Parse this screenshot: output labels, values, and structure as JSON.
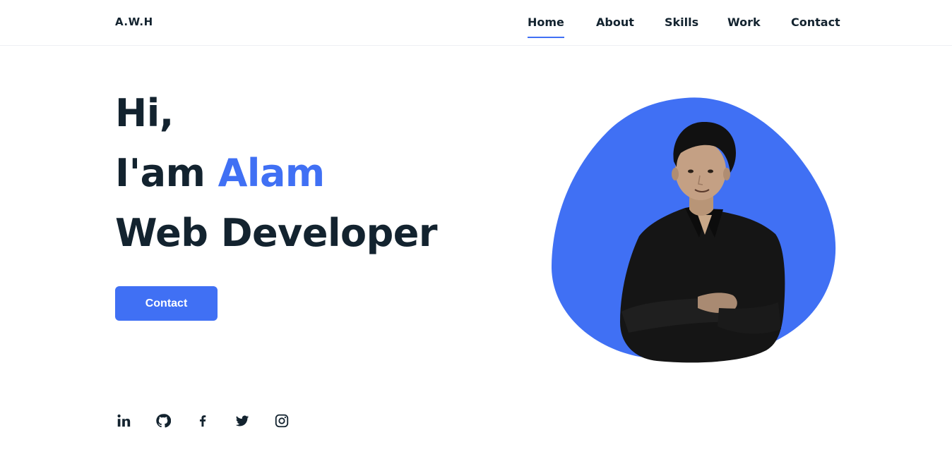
{
  "header": {
    "logo": "A.W.H",
    "nav": [
      {
        "label": "Home",
        "active": true
      },
      {
        "label": "About",
        "active": false
      },
      {
        "label": "Skills",
        "active": false
      },
      {
        "label": "Work",
        "active": false
      },
      {
        "label": "Contact",
        "active": false
      }
    ]
  },
  "hero": {
    "greeting": "Hi,",
    "intro_prefix": "I'am ",
    "name": "Alam",
    "role": "Web Developer",
    "cta_label": "Contact"
  },
  "socials": [
    {
      "icon": "linkedin-icon"
    },
    {
      "icon": "github-icon"
    },
    {
      "icon": "facebook-icon"
    },
    {
      "icon": "twitter-icon"
    },
    {
      "icon": "instagram-icon"
    }
  ],
  "colors": {
    "accent": "#4070f4",
    "text": "#13232f",
    "background": "#ffffff"
  }
}
